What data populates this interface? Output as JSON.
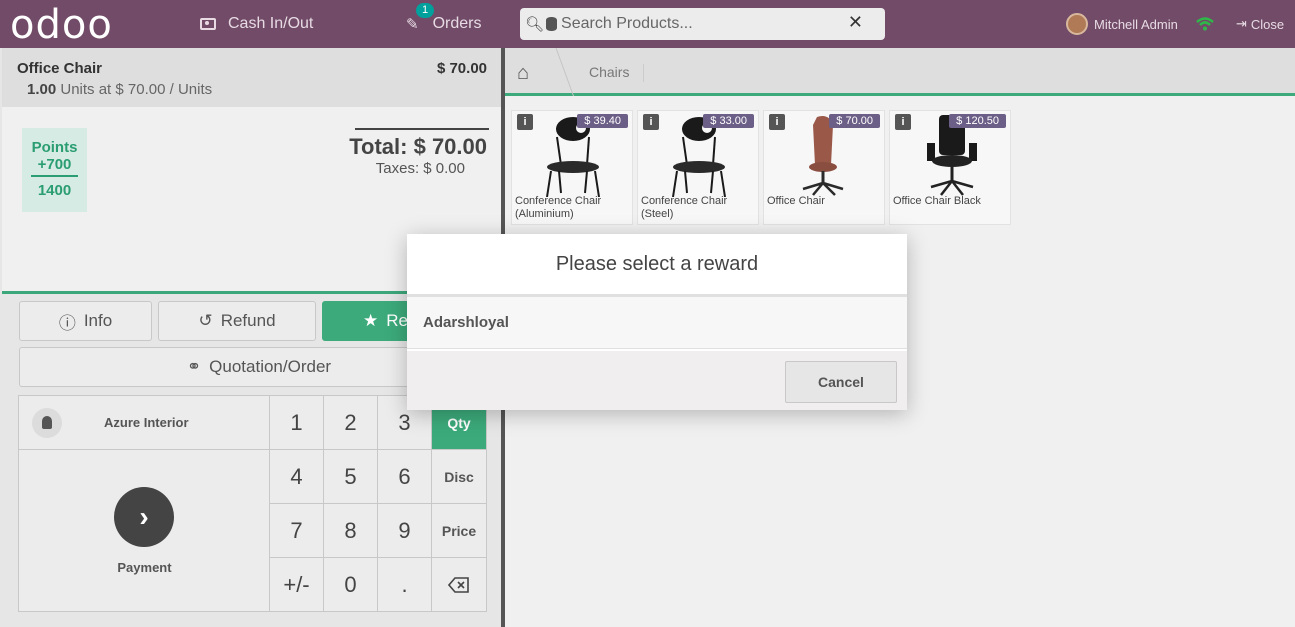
{
  "header": {
    "logo": "odoo",
    "cash_label": "Cash In/Out",
    "orders_label": "Orders",
    "orders_badge": "1",
    "search_placeholder": "Search Products...",
    "user_name": "Mitchell Admin",
    "close_label": "Close"
  },
  "order": {
    "line": {
      "name": "Office Chair",
      "price": "$ 70.00",
      "qty": "1.00",
      "unit_info": "Units at $ 70.00 / Units"
    },
    "points": {
      "label": "Points",
      "added": "+700",
      "total": "1400"
    },
    "total": "Total: $ 70.00",
    "taxes": "Taxes: $ 0.00"
  },
  "controls": {
    "info": "Info",
    "refund": "Refund",
    "reward": "Reward",
    "quotation": "Quotation/Order"
  },
  "pad": {
    "customer": "Azure Interior",
    "payment": "Payment",
    "keys": [
      "1",
      "2",
      "3",
      "4",
      "5",
      "6",
      "7",
      "8",
      "9",
      "+/-",
      "0",
      "."
    ],
    "modes": [
      "Qty",
      "Disc",
      "Price"
    ],
    "active_mode": "Qty"
  },
  "products": {
    "breadcrumb": "Chairs",
    "items": [
      {
        "name": "Conference Chair (Aluminium)",
        "price": "$ 39.40"
      },
      {
        "name": "Conference Chair (Steel)",
        "price": "$ 33.00"
      },
      {
        "name": "Office Chair",
        "price": "$ 70.00"
      },
      {
        "name": "Office Chair Black",
        "price": "$ 120.50"
      }
    ]
  },
  "modal": {
    "title": "Please select a reward",
    "option": "Adarshloyal",
    "cancel": "Cancel"
  },
  "colors": {
    "header": "#714B67",
    "accent": "#3caa7b",
    "price_tag": "#6c5f87"
  }
}
